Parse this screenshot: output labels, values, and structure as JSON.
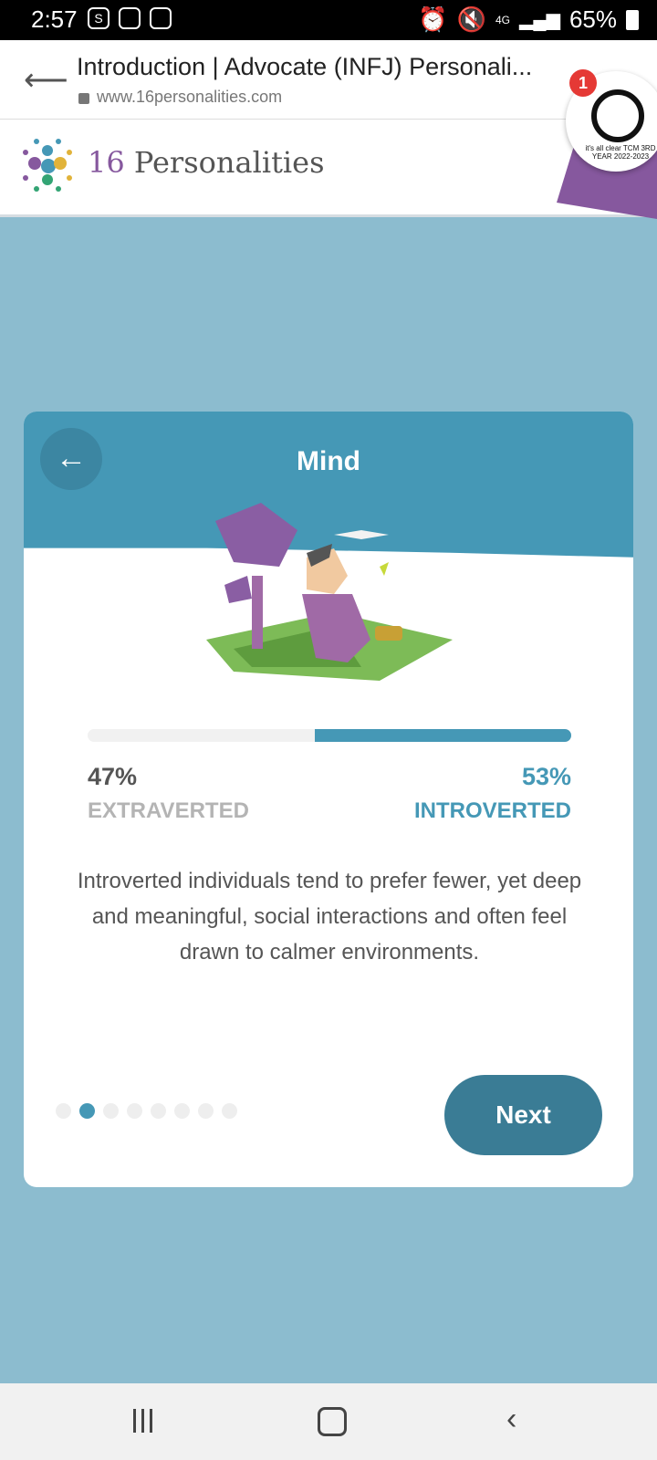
{
  "status": {
    "time": "2:57",
    "battery": "65%",
    "network": "4G"
  },
  "browser": {
    "title": "Introduction | Advocate (INFJ) Personali...",
    "url": "www.16personalities.com"
  },
  "site": {
    "logo_number": "16",
    "logo_word": "Personalities"
  },
  "overlay": {
    "badge_count": "1",
    "caption": "it's all clear TCM 3RD YEAR 2022-2023"
  },
  "card": {
    "title": "Mind",
    "left_percent": "47%",
    "left_label": "EXTRAVERTED",
    "right_percent": "53%",
    "right_label": "INTROVERTED",
    "introverted_fraction": 0.53,
    "description": "Introverted individuals tend to prefer fewer, yet deep and meaningful, social interactions and often feel drawn to calmer environments.",
    "next_label": "Next",
    "pager_total": 8,
    "pager_active_index": 1
  },
  "colors": {
    "accent": "#4598b6",
    "button": "#3a7c95",
    "page_bg": "#8cbccf",
    "logo_purple": "#86589e"
  }
}
